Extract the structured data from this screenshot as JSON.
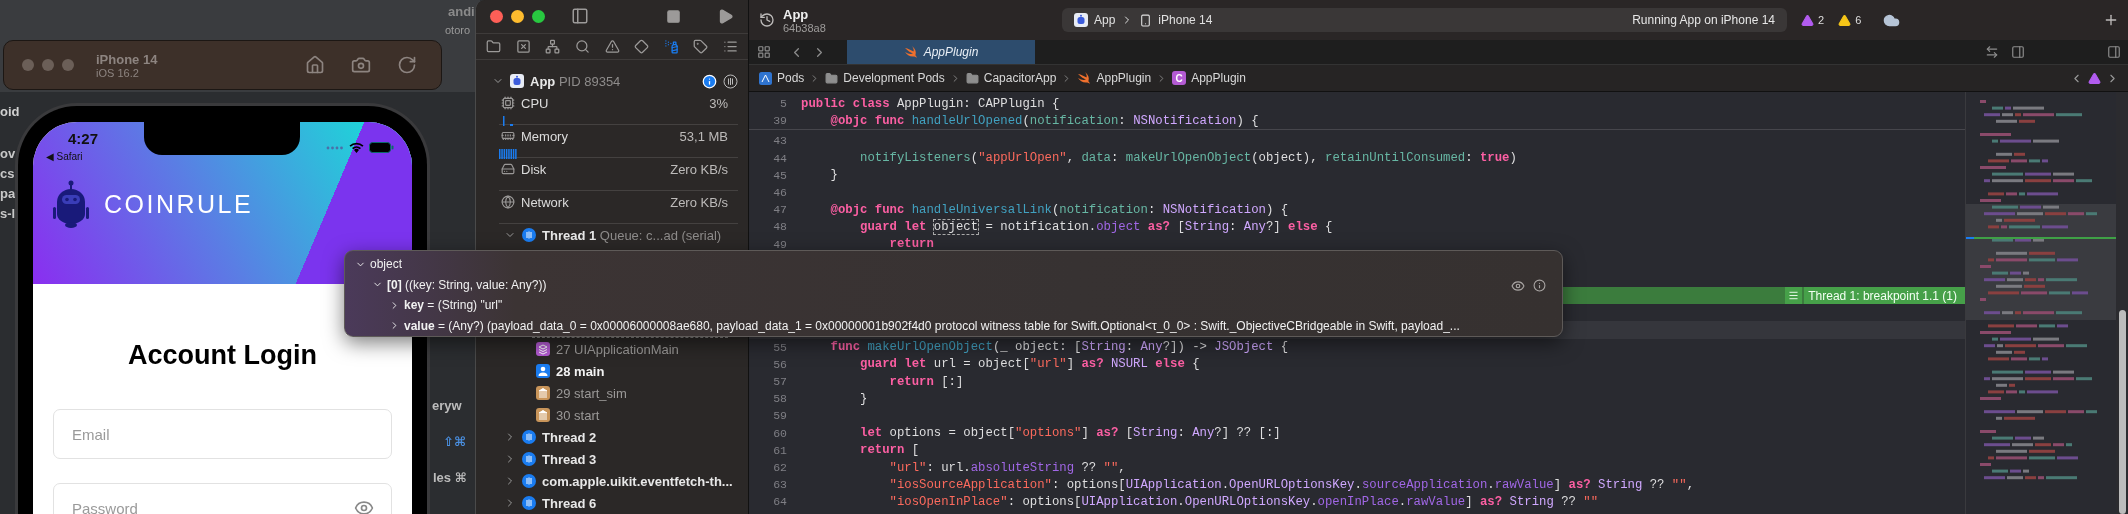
{
  "background_window": {
    "fragments": [
      "andi",
      "otoro",
      "oid",
      "ov",
      "cs",
      "pa",
      "s-l",
      "eryw",
      "⇧⌘",
      "les ⌘"
    ]
  },
  "simulator": {
    "device": "iPhone 14",
    "os": "iOS 16.2"
  },
  "phone": {
    "time": "4:27",
    "back_link": "◀ Safari",
    "brand": "COINRULE",
    "heading": "Account Login",
    "fields": [
      {
        "placeholder": "Email",
        "kind": "text"
      },
      {
        "placeholder": "Password",
        "kind": "password"
      }
    ]
  },
  "navigator": {
    "tabs": [
      {
        "kind": "project",
        "selected": false
      },
      {
        "kind": "source",
        "selected": false
      },
      {
        "kind": "symbol",
        "selected": false
      },
      {
        "kind": "find",
        "selected": false
      },
      {
        "kind": "issue",
        "selected": false
      },
      {
        "kind": "test",
        "selected": false
      },
      {
        "kind": "debug",
        "selected": true
      },
      {
        "kind": "breakpoint",
        "selected": false
      },
      {
        "kind": "report",
        "selected": false
      }
    ],
    "process": {
      "name": "App",
      "pid": "PID 89354",
      "expanded": true
    },
    "gauges": [
      {
        "kind": "cpu",
        "label": "CPU",
        "value": "3%"
      },
      {
        "kind": "memory",
        "label": "Memory",
        "value": "53,1 MB"
      },
      {
        "kind": "disk",
        "label": "Disk",
        "value": "Zero KB/s"
      },
      {
        "kind": "network",
        "label": "Network",
        "value": "Zero KB/s"
      }
    ],
    "threads": [
      {
        "name": "Thread 1",
        "detail": "Queue: c...ad (serial)",
        "expanded": true,
        "frames": [
          {
            "label": "27 UIApplicationMain",
            "kind": "framework"
          },
          {
            "label": "28 main",
            "kind": "user"
          },
          {
            "label": "29 start_sim",
            "kind": "system"
          },
          {
            "label": "30 start",
            "kind": "system"
          }
        ]
      },
      {
        "name": "Thread 2",
        "expanded": false
      },
      {
        "name": "Thread 3",
        "expanded": false
      },
      {
        "name": "com.apple.uikit.eventfetch-th...",
        "expanded": false
      },
      {
        "name": "Thread 6",
        "expanded": false
      }
    ]
  },
  "toolbar": {
    "project": "App",
    "commit": "64b38a8",
    "scheme": "App",
    "destination": "iPhone 14",
    "status": "Running App on iPhone 14",
    "issues": [
      {
        "kind": "runtime",
        "count": "2"
      },
      {
        "kind": "warning",
        "count": "6"
      }
    ]
  },
  "editor_tabs": [
    {
      "title": "AppPlugin",
      "selected": true
    }
  ],
  "breadcrumb": [
    {
      "label": "Pods",
      "kind": "project"
    },
    {
      "label": "Development Pods",
      "kind": "folder"
    },
    {
      "label": "CapacitorApp",
      "kind": "folder"
    },
    {
      "label": "AppPlugin",
      "kind": "swift"
    },
    {
      "label": "AppPlugin",
      "kind": "class",
      "badge": "C"
    }
  ],
  "code": [
    {
      "number": "5",
      "kind": "sticky",
      "tokens": [
        {
          "text": "public class",
          "kind": "kw"
        },
        {
          "text": " AppPlugin: CAPPlugin {",
          "kind": "plain"
        }
      ]
    },
    {
      "number": "39",
      "kind": "sticky",
      "tokens": [
        {
          "text": "    @objc func ",
          "kind": "kw"
        },
        {
          "text": "handleUrlOpened",
          "kind": "decl"
        },
        {
          "text": "(",
          "kind": "plain"
        },
        {
          "text": "notification",
          "kind": "call"
        },
        {
          "text": ": ",
          "kind": "plain"
        },
        {
          "text": "NSNotification",
          "kind": "type"
        },
        {
          "text": ") {",
          "kind": "plain"
        }
      ]
    },
    {
      "number": "43",
      "kind": "code"
    },
    {
      "number": "44",
      "kind": "code",
      "tokens": [
        {
          "text": "        notifyListeners",
          "kind": "call"
        },
        {
          "text": "(",
          "kind": "plain"
        },
        {
          "text": "\"appUrlOpen\"",
          "kind": "str"
        },
        {
          "text": ", ",
          "kind": "plain"
        },
        {
          "text": "data",
          "kind": "call"
        },
        {
          "text": ": ",
          "kind": "plain"
        },
        {
          "text": "makeUrlOpenObject",
          "kind": "call"
        },
        {
          "text": "(object), ",
          "kind": "plain"
        },
        {
          "text": "retainUntilConsumed",
          "kind": "call"
        },
        {
          "text": ": ",
          "kind": "plain"
        },
        {
          "text": "true",
          "kind": "kw"
        },
        {
          "text": ")",
          "kind": "plain"
        }
      ]
    },
    {
      "number": "45",
      "kind": "code",
      "tokens": [
        {
          "text": "    }",
          "kind": "plain"
        }
      ]
    },
    {
      "number": "46",
      "kind": "code"
    },
    {
      "number": "47",
      "kind": "code",
      "tokens": [
        {
          "text": "    @objc func ",
          "kind": "kw"
        },
        {
          "text": "handleUniversalLink",
          "kind": "decl"
        },
        {
          "text": "(",
          "kind": "plain"
        },
        {
          "text": "notification",
          "kind": "call"
        },
        {
          "text": ": ",
          "kind": "plain"
        },
        {
          "text": "NSNotification",
          "kind": "type"
        },
        {
          "text": ") {",
          "kind": "plain"
        }
      ]
    },
    {
      "number": "48",
      "kind": "code",
      "tokens": [
        {
          "text": "        guard let ",
          "kind": "kw"
        },
        {
          "text": "object",
          "kind": "hover"
        },
        {
          "text": " = notification.",
          "kind": "plain"
        },
        {
          "text": "object",
          "kind": "prop"
        },
        {
          "text": " as?",
          "kind": "kw"
        },
        {
          "text": " [",
          "kind": "plain"
        },
        {
          "text": "String",
          "kind": "type"
        },
        {
          "text": ": ",
          "kind": "plain"
        },
        {
          "text": "Any",
          "kind": "type"
        },
        {
          "text": "?] ",
          "kind": "plain"
        },
        {
          "text": "else",
          "kind": "kw"
        },
        {
          "text": " {",
          "kind": "plain"
        }
      ]
    },
    {
      "number": "49",
      "kind": "code",
      "tokens": [
        {
          "text": "            return",
          "kind": "kw"
        }
      ]
    },
    {
      "kind": "covered"
    },
    {
      "kind": "covered"
    },
    {
      "kind": "breakpoint",
      "label": "Thread 1: breakpoint 1.1 (1)"
    },
    {
      "kind": "covered"
    },
    {
      "kind": "current"
    },
    {
      "number": "55",
      "kind": "code",
      "tokens": [
        {
          "text": "    func ",
          "kind": "kw"
        },
        {
          "text": "makeUrlOpenObject",
          "kind": "decl"
        },
        {
          "text": "(_ object: [",
          "kind": "plain"
        },
        {
          "text": "String",
          "kind": "type"
        },
        {
          "text": ": ",
          "kind": "plain"
        },
        {
          "text": "Any",
          "kind": "type"
        },
        {
          "text": "?]) -> ",
          "kind": "plain"
        },
        {
          "text": "JSObject",
          "kind": "type"
        },
        {
          "text": " {",
          "kind": "plain"
        }
      ]
    },
    {
      "number": "56",
      "kind": "code",
      "tokens": [
        {
          "text": "        guard let",
          "kind": "kw"
        },
        {
          "text": " url = object[",
          "kind": "plain"
        },
        {
          "text": "\"url\"",
          "kind": "str"
        },
        {
          "text": "] ",
          "kind": "plain"
        },
        {
          "text": "as?",
          "kind": "kw"
        },
        {
          "text": " NSURL",
          "kind": "type"
        },
        {
          "text": " else",
          "kind": "kw"
        },
        {
          "text": " {",
          "kind": "plain"
        }
      ]
    },
    {
      "number": "57",
      "kind": "code",
      "tokens": [
        {
          "text": "            return",
          "kind": "kw"
        },
        {
          "text": " [:]",
          "kind": "plain"
        }
      ]
    },
    {
      "number": "58",
      "kind": "code",
      "tokens": [
        {
          "text": "        }",
          "kind": "plain"
        }
      ]
    },
    {
      "number": "59",
      "kind": "code"
    },
    {
      "number": "60",
      "kind": "code",
      "tokens": [
        {
          "text": "        let",
          "kind": "kw"
        },
        {
          "text": " options = object[",
          "kind": "plain"
        },
        {
          "text": "\"options\"",
          "kind": "str"
        },
        {
          "text": "] ",
          "kind": "plain"
        },
        {
          "text": "as?",
          "kind": "kw"
        },
        {
          "text": " [",
          "kind": "plain"
        },
        {
          "text": "String",
          "kind": "type"
        },
        {
          "text": ": ",
          "kind": "plain"
        },
        {
          "text": "Any",
          "kind": "type"
        },
        {
          "text": "?] ?? [:]",
          "kind": "plain"
        }
      ]
    },
    {
      "number": "61",
      "kind": "code",
      "tokens": [
        {
          "text": "        return",
          "kind": "kw"
        },
        {
          "text": " [",
          "kind": "plain"
        }
      ]
    },
    {
      "number": "62",
      "kind": "code",
      "tokens": [
        {
          "text": "            \"url\"",
          "kind": "str"
        },
        {
          "text": ": url.",
          "kind": "plain"
        },
        {
          "text": "absoluteString",
          "kind": "prop"
        },
        {
          "text": " ?? ",
          "kind": "plain"
        },
        {
          "text": "\"\"",
          "kind": "str"
        },
        {
          "text": ",",
          "kind": "plain"
        }
      ]
    },
    {
      "number": "63",
      "kind": "code",
      "tokens": [
        {
          "text": "            \"iosSourceApplication\"",
          "kind": "str"
        },
        {
          "text": ": options[",
          "kind": "plain"
        },
        {
          "text": "UIApplication",
          "kind": "type"
        },
        {
          "text": ".",
          "kind": "plain"
        },
        {
          "text": "OpenURLOptionsKey",
          "kind": "type"
        },
        {
          "text": ".",
          "kind": "plain"
        },
        {
          "text": "sourceApplication",
          "kind": "prop"
        },
        {
          "text": ".",
          "kind": "plain"
        },
        {
          "text": "rawValue",
          "kind": "prop"
        },
        {
          "text": "] ",
          "kind": "plain"
        },
        {
          "text": "as?",
          "kind": "kw"
        },
        {
          "text": " String",
          "kind": "type"
        },
        {
          "text": " ?? ",
          "kind": "plain"
        },
        {
          "text": "\"\"",
          "kind": "str"
        },
        {
          "text": ",",
          "kind": "plain"
        }
      ]
    },
    {
      "number": "64",
      "kind": "code",
      "tokens": [
        {
          "text": "            \"iosOpenInPlace\"",
          "kind": "str"
        },
        {
          "text": ": options[",
          "kind": "plain"
        },
        {
          "text": "UIApplication",
          "kind": "type"
        },
        {
          "text": ".",
          "kind": "plain"
        },
        {
          "text": "OpenURLOptionsKey",
          "kind": "type"
        },
        {
          "text": ".",
          "kind": "plain"
        },
        {
          "text": "openInPlace",
          "kind": "prop"
        },
        {
          "text": ".",
          "kind": "plain"
        },
        {
          "text": "rawValue",
          "kind": "prop"
        },
        {
          "text": "] ",
          "kind": "plain"
        },
        {
          "text": "as?",
          "kind": "kw"
        },
        {
          "text": " String",
          "kind": "type"
        },
        {
          "text": " ?? ",
          "kind": "plain"
        },
        {
          "text": "\"\"",
          "kind": "str"
        }
      ]
    }
  ],
  "popover": {
    "rows": [
      {
        "label": "object",
        "expanded": true,
        "children": [
          {
            "label": "**[0]** ((key: String, value: Any?))",
            "expanded": true,
            "children": [
              {
                "label": "**key** = (String) \"url\"",
                "expanded": false
              },
              {
                "label": "**value** = (Any?) (payload_data_0 = 0x00006000008ae680, payload_data_1 = 0x00000001b902f4d0 protocol witness table for Swift.Optional<τ_0_0> : Swift._ObjectiveCBridgeable in Swift, payload_...",
                "expanded": false
              }
            ]
          }
        ]
      }
    ]
  }
}
